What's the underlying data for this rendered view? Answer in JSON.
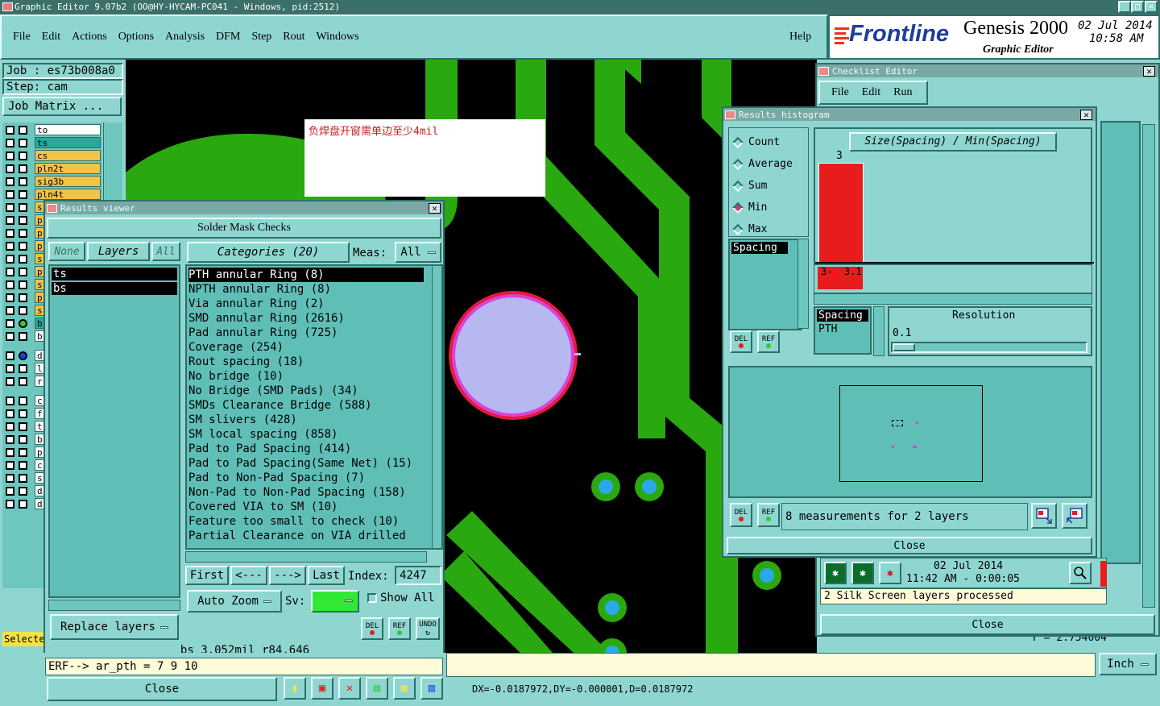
{
  "title_bar": "Graphic Editor 9.07b2  (OO@HY-HYCAM-PC041 - Windows, pid:2512)",
  "menu": [
    "File",
    "Edit",
    "Actions",
    "Options",
    "Analysis",
    "DFM",
    "Step",
    "Rout",
    "Windows"
  ],
  "help": "Help",
  "brand": {
    "logo": "Frontline",
    "product": "Genesis 2000",
    "subtitle": "Graphic Editor",
    "date": "02 Jul 2014",
    "time": "10:58 AM"
  },
  "job": {
    "job": "Job : es73b008a0",
    "step": "Step: cam",
    "matrix": "Job Matrix ..."
  },
  "layers": [
    {
      "n": "to",
      "c": "#ffffff"
    },
    {
      "n": "ts",
      "c": "#2aa89a"
    },
    {
      "n": "cs",
      "c": "#f2c24a"
    },
    {
      "n": "pln2t",
      "c": "#f2c24a"
    },
    {
      "n": "sig3b",
      "c": "#f2c24a"
    },
    {
      "n": "pln4t",
      "c": "#f2c24a"
    },
    {
      "n": "s",
      "c": "#f2c24a"
    },
    {
      "n": "p",
      "c": "#f2c24a"
    },
    {
      "n": "p",
      "c": "#f2c24a"
    },
    {
      "n": "p",
      "c": "#f2c24a"
    },
    {
      "n": "s",
      "c": "#f2c24a"
    },
    {
      "n": "p",
      "c": "#f2c24a"
    },
    {
      "n": "s",
      "c": "#f2c24a"
    },
    {
      "n": "p",
      "c": "#f2c24a"
    },
    {
      "n": "s",
      "c": "#f2c24a"
    },
    {
      "n": "b",
      "c": "#2aa89a"
    },
    {
      "n": "b",
      "c": "#ffffff"
    },
    {
      "n": "d",
      "c": "#ffffff"
    },
    {
      "n": "l",
      "c": "#ffffff"
    },
    {
      "n": "r",
      "c": "#ffffff"
    },
    {
      "n": "c",
      "c": "#ffffff"
    },
    {
      "n": "f",
      "c": "#ffffff"
    },
    {
      "n": "t",
      "c": "#ffffff"
    },
    {
      "n": "b",
      "c": "#ffffff"
    },
    {
      "n": "p",
      "c": "#ffffff"
    },
    {
      "n": "c",
      "c": "#ffffff"
    },
    {
      "n": "s",
      "c": "#ffffff"
    },
    {
      "n": "d",
      "c": "#ffffff"
    },
    {
      "n": "d",
      "c": "#ffffff"
    }
  ],
  "selected_label": "Selecte",
  "note": "负焊盘开窗需单边至少4mil",
  "results_viewer": {
    "title": "Results viewer",
    "header": "Solder Mask Checks",
    "none": "None",
    "layers_btn": "Layers",
    "all": "All",
    "categories": "Categories (20)",
    "meas": "Meas:",
    "meas_val": "All",
    "layer_list": [
      "ts",
      "bs"
    ],
    "items": [
      "PTH annular Ring (8)",
      "NPTH annular Ring (8)",
      "Via annular Ring (2)",
      "SMD annular Ring (2616)",
      "Pad annular Ring (725)",
      "Coverage (254)",
      "Rout spacing (18)",
      "No bridge (10)",
      "No Bridge (SMD Pads) (34)",
      "SMDs Clearance Bridge (588)",
      "SM slivers (428)",
      "SM local spacing (858)",
      "Pad to Pad Spacing (414)",
      "Pad to Pad Spacing(Same Net) (15)",
      "Pad to Non-Pad Spacing (7)",
      "Non-Pad to Non-Pad Spacing (158)",
      "Covered VIA to SM (10)",
      "Feature too small to check (10)",
      "Partial Clearance on VIA drilled"
    ],
    "first": "First",
    "prev": "<---",
    "next": "--->",
    "last": "Last",
    "index_label": "Index:",
    "index_val": "4247",
    "auto_zoom": "Auto Zoom",
    "sv": "Sv:",
    "show_all": "Show All",
    "replace": "Replace layers",
    "del": "DEL",
    "ref": "REF",
    "undo": "UNDO",
    "status": "bs 3.052mil  r84.646",
    "close": "Close"
  },
  "cmd": "ERF--> ar_pth = 7 9 10",
  "coords": "DX=-0.0187972,DY=-0.000001,D=0.0187972",
  "unit": "Inch",
  "y_readout": "Y = 2.754004",
  "checklist": {
    "title": "Checklist Editor",
    "menu": [
      "File",
      "Edit",
      "Run"
    ],
    "date": "02 Jul 2014",
    "time": "11:42 AM - 0:00:05",
    "msg": "2 Silk Screen layers processed",
    "close": "Close"
  },
  "histogram": {
    "title": "Results histogram",
    "modes": [
      "Count",
      "Average",
      "Sum",
      "Min",
      "Max"
    ],
    "selected_mode": "Min",
    "heading": "Size(Spacing) / Min(Spacing)",
    "bar_count": "3",
    "bar_range": "3-  3.1",
    "list1": "Spacing",
    "list2": [
      "Spacing",
      "PTH"
    ],
    "resolution_label": "Resolution",
    "resolution_val": "0.1",
    "summary": "8 measurements for 2 layers",
    "close": "Close",
    "del": "DEL",
    "ref": "REF"
  }
}
